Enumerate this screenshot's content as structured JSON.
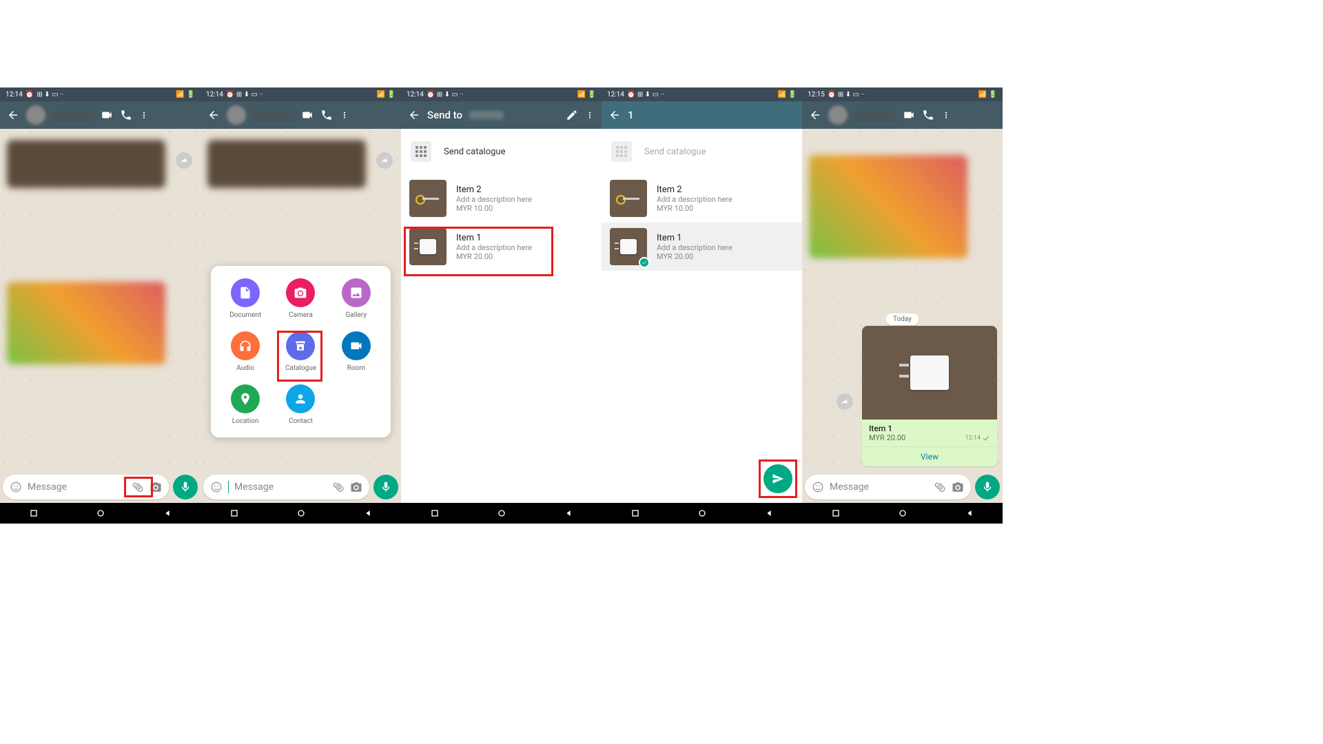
{
  "status": {
    "time1": "12:14",
    "time5": "12:15"
  },
  "input": {
    "placeholder": "Message"
  },
  "attach": {
    "document": "Document",
    "camera": "Camera",
    "gallery": "Gallery",
    "audio": "Audio",
    "catalogue": "Catalogue",
    "room": "Room",
    "location": "Location",
    "contact": "Contact"
  },
  "colors": {
    "document": "#7B66FF",
    "camera": "#E91E63",
    "gallery": "#B968C7",
    "audio": "#FF6F3C",
    "catalogue": "#5E6CEA",
    "room": "#0277BD",
    "location": "#1FA855",
    "contact": "#0EA5E9"
  },
  "sendto": {
    "title": "Send to",
    "catalogue_label": "Send catalogue",
    "items": [
      {
        "name": "Item 2",
        "desc": "Add a description here",
        "price": "MYR 10.00"
      },
      {
        "name": "Item 1",
        "desc": "Add a description here",
        "price": "MYR 20.00"
      }
    ]
  },
  "selected": {
    "count": "1"
  },
  "chat": {
    "today": "Today"
  },
  "product": {
    "name": "Item 1",
    "price": "MYR 20.00",
    "time": "12:14",
    "view": "View"
  }
}
